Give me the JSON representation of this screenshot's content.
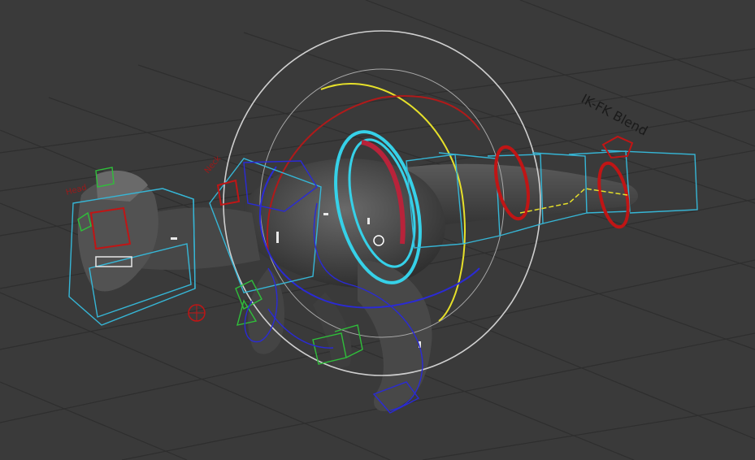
{
  "viewport": {
    "background": "#3a3a3a",
    "grid_color": "#2c2c2c",
    "controls": {
      "ikfk_blend_label": "IK-FK Blend",
      "head_label": "Head",
      "neck_label": "Neck"
    },
    "colors": {
      "mesh": "#4a4a4a",
      "cyan": "#36d1e8",
      "yellow": "#e6e02a",
      "red": "#c81e1e",
      "blue": "#2a2ad6",
      "green": "#2fbf3a",
      "white_ring": "#c9c9c9"
    }
  }
}
